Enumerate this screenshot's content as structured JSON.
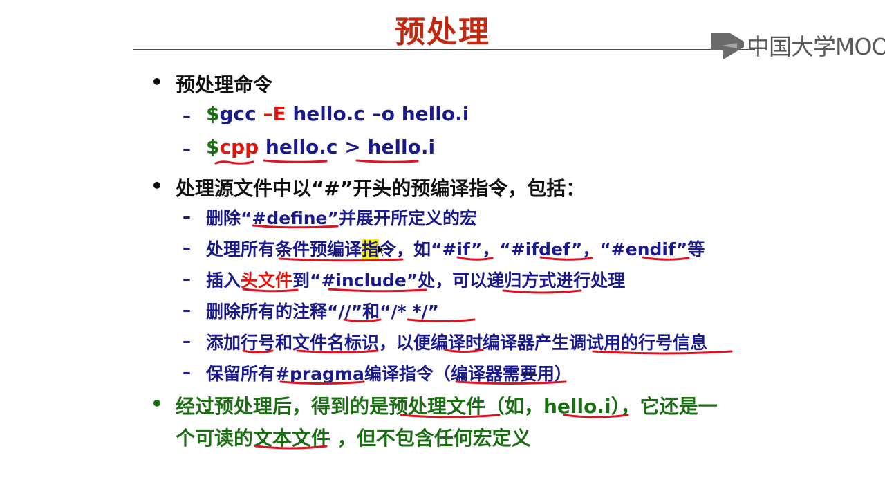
{
  "slide": {
    "title": "预处理",
    "watermark": "中国大学MOOC",
    "colors": {
      "title": "#c0280f",
      "body_black": "#111111",
      "body_blue": "#1a1a8c",
      "command_green": "#1c6e14",
      "command_red": "#e0160c",
      "annotation_red": "#e3101f",
      "highlight": "#f2ec1c",
      "summary_green": "#1c6e14"
    },
    "bullet_symbol": "•",
    "dash_symbol": "–",
    "section1": {
      "heading": "预处理命令",
      "cmd1": {
        "prompt": "$",
        "program": "gcc",
        "flag": "–E",
        "args": "hello.c –o hello.i"
      },
      "cmd2": {
        "prompt": "$",
        "program": "cpp",
        "input": "hello.c",
        "redirect": ">",
        "output": "hello.i"
      }
    },
    "section2": {
      "heading": "处理源文件中以“#”开头的预编译指令，包括：",
      "items": [
        {
          "text": "删除“#define”并展开所定义的宏"
        },
        {
          "before": "处理所有条件预编译",
          "highlight": "指",
          "after": "令，如“#if”，“#ifdef”，“#endif”等"
        },
        {
          "prefix": "插入",
          "red": "头文件",
          "suffix": "到“#include”处，可以递归方式进行处理"
        },
        {
          "text": "删除所有的注释“//”和“/* */”"
        },
        {
          "text": "添加行号和文件名标识，以便编译时编译器产生调试用的行号信息"
        },
        {
          "text": "保留所有#pragma编译指令（编译器需要用）"
        }
      ]
    },
    "section3": {
      "line1": "经过预处理后，得到的是预处理文件（如，hello.i），它还是一",
      "line2": "个可读的文本文件 ，但不包含任何宏定义"
    }
  }
}
